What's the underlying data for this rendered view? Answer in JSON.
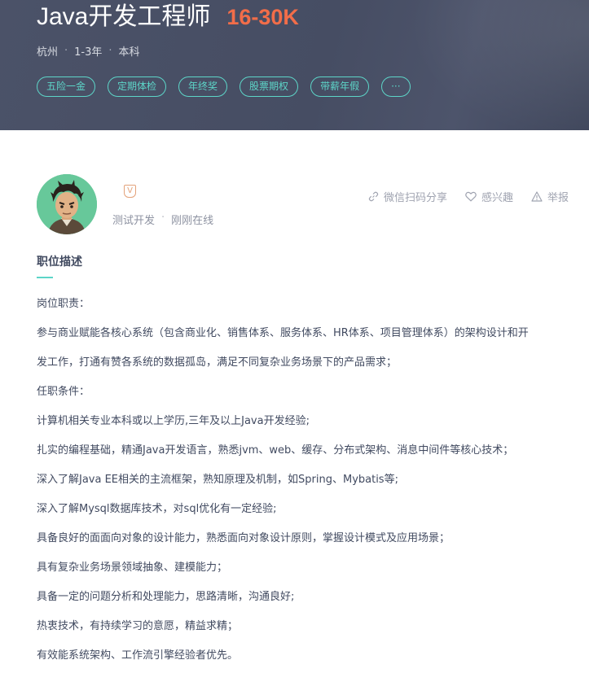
{
  "job": {
    "title": "Java开发工程师",
    "salary": "16-30K",
    "city": "杭州",
    "experience": "1-3年",
    "education": "本科",
    "tags": [
      "五险一金",
      "定期体检",
      "年终奖",
      "股票期权",
      "带薪年假",
      "···"
    ]
  },
  "recruiter": {
    "badge": "V",
    "position": "测试开发",
    "status": "刚刚在线"
  },
  "actions": {
    "share": "微信扫码分享",
    "interest": "感兴趣",
    "report": "举报"
  },
  "description": {
    "title": "职位描述",
    "lines": [
      "岗位职责：",
      "参与商业赋能各核心系统（包含商业化、销售体系、服务体系、HR体系、项目管理体系）的架构设计和开",
      "发工作，打通有赞各系统的数据孤岛，满足不同复杂业务场景下的产品需求；",
      "任职条件：",
      "计算机相关专业本科或以上学历,三年及以上Java开发经验;",
      "扎实的编程基础，精通Java开发语言，熟悉jvm、web、缓存、分布式架构、消息中间件等核心技术；",
      "深入了解Java EE相关的主流框架，熟知原理及机制，如Spring、Mybatis等;",
      "深入了解Mysql数据库技术，对sql优化有一定经验;",
      "具备良好的面面向对象的设计能力，熟悉面向对象设计原则，掌握设计模式及应用场景；",
      "具有复杂业务场景领域抽象、建模能力；",
      "具备一定的问题分析和处理能力，思路清晰，沟通良好;",
      "热衷技术，有持续学习的意愿，精益求精；",
      "有效能系统架构、工作流引擎经验者优先。"
    ]
  },
  "colors": {
    "header_bg": "#464d63",
    "salary": "#f26d49",
    "accent": "#5dd5c8",
    "badge": "#e3a27a"
  }
}
